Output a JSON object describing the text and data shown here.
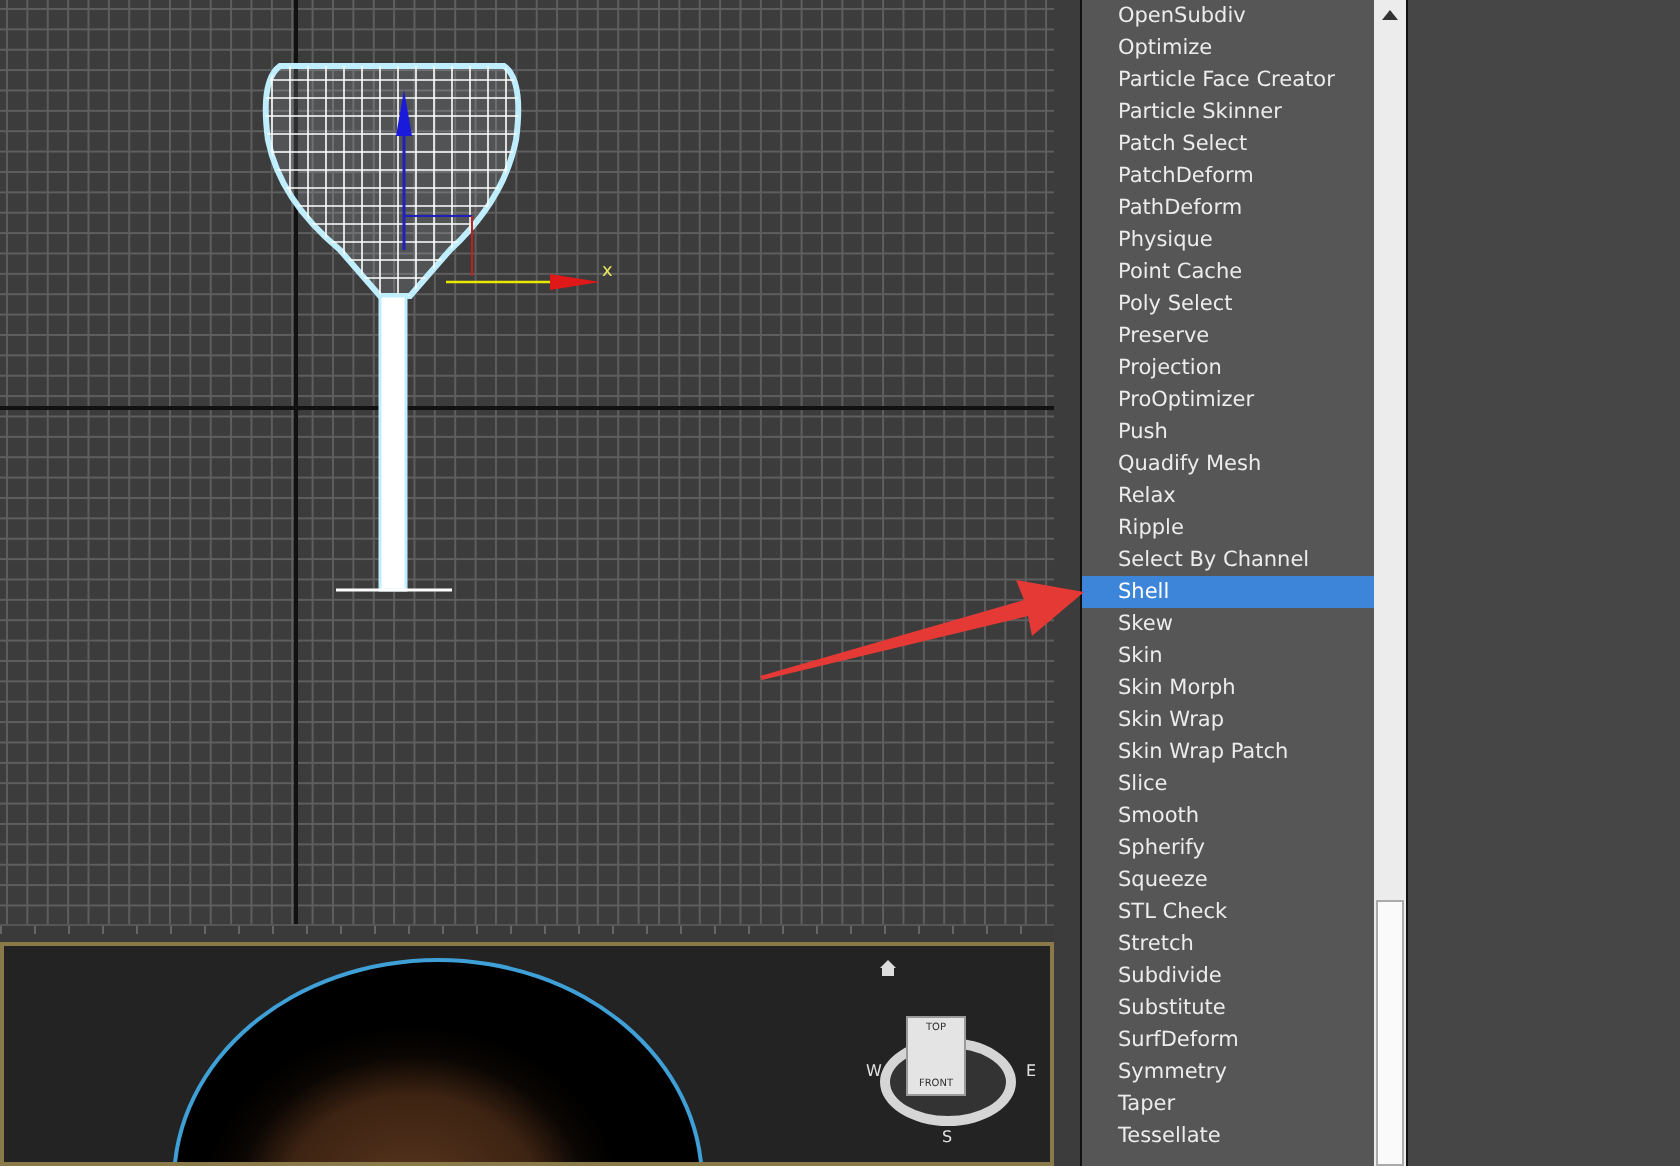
{
  "top_viewport": {
    "axis_label": "x"
  },
  "perspective_viewport": {
    "viewcube": {
      "top": "TOP",
      "front": "FRONT",
      "compass": [
        "W",
        "E",
        "S"
      ]
    }
  },
  "modifier_list": {
    "items": [
      {
        "label": "OpenSubdiv",
        "selected": false
      },
      {
        "label": "Optimize",
        "selected": false
      },
      {
        "label": "Particle Face Creator",
        "selected": false
      },
      {
        "label": "Particle Skinner",
        "selected": false
      },
      {
        "label": "Patch Select",
        "selected": false
      },
      {
        "label": "PatchDeform",
        "selected": false
      },
      {
        "label": "PathDeform",
        "selected": false
      },
      {
        "label": "Physique",
        "selected": false
      },
      {
        "label": "Point Cache",
        "selected": false
      },
      {
        "label": "Poly Select",
        "selected": false
      },
      {
        "label": "Preserve",
        "selected": false
      },
      {
        "label": "Projection",
        "selected": false
      },
      {
        "label": "ProOptimizer",
        "selected": false
      },
      {
        "label": "Push",
        "selected": false
      },
      {
        "label": "Quadify Mesh",
        "selected": false
      },
      {
        "label": "Relax",
        "selected": false
      },
      {
        "label": "Ripple",
        "selected": false
      },
      {
        "label": "Select By Channel",
        "selected": false
      },
      {
        "label": "Shell",
        "selected": true
      },
      {
        "label": "Skew",
        "selected": false
      },
      {
        "label": "Skin",
        "selected": false
      },
      {
        "label": "Skin Morph",
        "selected": false
      },
      {
        "label": "Skin Wrap",
        "selected": false
      },
      {
        "label": "Skin Wrap Patch",
        "selected": false
      },
      {
        "label": "Slice",
        "selected": false
      },
      {
        "label": "Smooth",
        "selected": false
      },
      {
        "label": "Spherify",
        "selected": false
      },
      {
        "label": "Squeeze",
        "selected": false
      },
      {
        "label": "STL Check",
        "selected": false
      },
      {
        "label": "Stretch",
        "selected": false
      },
      {
        "label": "Subdivide",
        "selected": false
      },
      {
        "label": "Substitute",
        "selected": false
      },
      {
        "label": "SurfDeform",
        "selected": false
      },
      {
        "label": "Symmetry",
        "selected": false
      },
      {
        "label": "Taper",
        "selected": false
      },
      {
        "label": "Tessellate",
        "selected": false
      }
    ]
  }
}
